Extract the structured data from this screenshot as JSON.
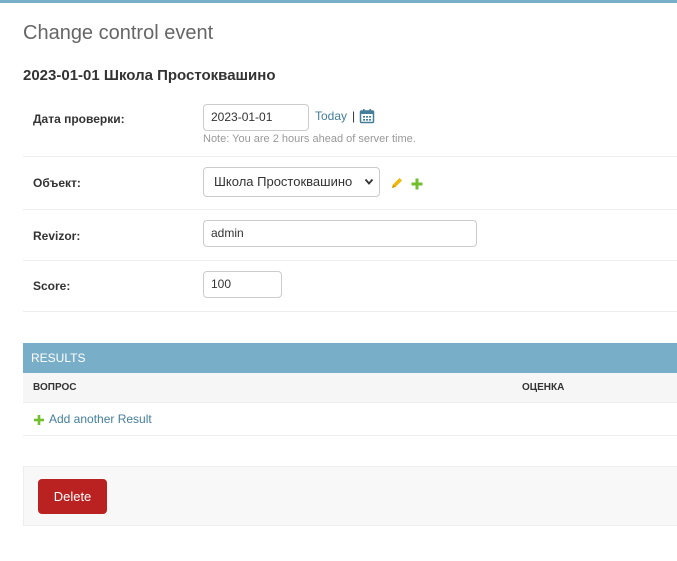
{
  "page": {
    "title": "Change control event",
    "object_title": "2023-01-01 Школа Простоквашино"
  },
  "form": {
    "date": {
      "label": "Дата проверки:",
      "value": "2023-01-01",
      "today_label": "Today",
      "separator": "|",
      "calendar_icon": "calendar-icon",
      "help": "Note: You are 2 hours ahead of server time."
    },
    "object": {
      "label": "Объект:",
      "selected": "Школа Простоквашино",
      "edit_icon": "pencil-icon",
      "add_icon": "plus-icon"
    },
    "revizor": {
      "label": "Revizor:",
      "value": "admin"
    },
    "score": {
      "label": "Score:",
      "value": "100"
    }
  },
  "results": {
    "caption": "RESULTS",
    "columns": [
      "ВОПРОС",
      "ОЦЕНКА"
    ],
    "add_label": "Add another Result"
  },
  "actions": {
    "delete_label": "Delete"
  },
  "colors": {
    "accent": "#79aec8",
    "link": "#447e9b",
    "delete": "#ba2121",
    "add_green": "#70bf2b",
    "edit_yellow": "#efb80b"
  }
}
